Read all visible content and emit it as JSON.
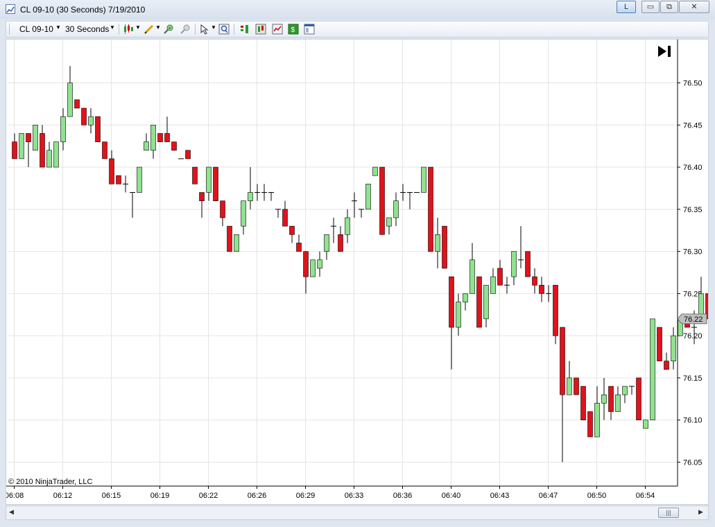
{
  "window": {
    "title": "CL 09-10 (30 Seconds)  7/19/2010",
    "buttons": {
      "lock": "L",
      "minimize": "▭",
      "restore": "⧉",
      "close": "✕"
    }
  },
  "toolbar": {
    "instrument": "CL 09-10",
    "interval": "30 Seconds",
    "icons": [
      "candlestick-icon",
      "pencil-icon",
      "zoom-in-icon",
      "zoom-out-icon",
      "cursor-icon",
      "magnify-icon",
      "bar-chart-icon",
      "candles-icon",
      "line-chart-icon",
      "dollar-icon",
      "properties-icon"
    ]
  },
  "colors": {
    "up": "#90e290",
    "down": "#e0131b",
    "wick": "#000000",
    "grid": "#e4e4e4",
    "price_marker": "#c0c0c0"
  },
  "chart": {
    "copyright": "© 2010 NinjaTrader, LLC",
    "end_button_icon": "go-to-end-icon",
    "last_price": "76.22"
  },
  "chart_data": {
    "type": "candlestick",
    "symbol": "CL 09-10",
    "interval": "30 Seconds",
    "date": "7/19/2010",
    "ylim": [
      76.03,
      76.55
    ],
    "y_ticks": [
      "76.50",
      "76.45",
      "76.40",
      "76.35",
      "76.30",
      "76.25",
      "76.20",
      "76.15",
      "76.10",
      "76.05"
    ],
    "x_ticks": [
      "06:08",
      "06:12",
      "06:15",
      "06:19",
      "06:22",
      "06:26",
      "06:29",
      "06:33",
      "06:36",
      "06:40",
      "06:43",
      "06:47",
      "06:50",
      "06:54"
    ],
    "candles": [
      [
        76.43,
        76.44,
        76.41,
        76.41
      ],
      [
        76.41,
        76.44,
        76.41,
        76.44
      ],
      [
        76.44,
        76.44,
        76.4,
        76.43
      ],
      [
        76.42,
        76.45,
        76.42,
        76.45
      ],
      [
        76.44,
        76.45,
        76.4,
        76.4
      ],
      [
        76.4,
        76.43,
        76.4,
        76.42
      ],
      [
        76.4,
        76.43,
        76.4,
        76.43
      ],
      [
        76.43,
        76.47,
        76.42,
        76.46
      ],
      [
        76.46,
        76.52,
        76.46,
        76.5
      ],
      [
        76.48,
        76.48,
        76.47,
        76.47
      ],
      [
        76.47,
        76.47,
        76.45,
        76.45
      ],
      [
        76.45,
        76.47,
        76.44,
        76.46
      ],
      [
        76.46,
        76.46,
        76.43,
        76.43
      ],
      [
        76.43,
        76.43,
        76.41,
        76.41
      ],
      [
        76.41,
        76.42,
        76.38,
        76.38
      ],
      [
        76.39,
        76.39,
        76.38,
        76.38
      ],
      [
        76.38,
        76.39,
        76.37,
        76.38
      ],
      [
        76.37,
        76.37,
        76.34,
        76.37
      ],
      [
        76.37,
        76.4,
        76.37,
        76.4
      ],
      [
        76.42,
        76.44,
        76.42,
        76.43
      ],
      [
        76.42,
        76.45,
        76.41,
        76.45
      ],
      [
        76.44,
        76.44,
        76.43,
        76.43
      ],
      [
        76.44,
        76.46,
        76.43,
        76.43
      ],
      [
        76.43,
        76.43,
        76.42,
        76.42
      ],
      [
        76.41,
        76.41,
        76.41,
        76.41
      ],
      [
        76.42,
        76.42,
        76.41,
        76.41
      ],
      [
        76.4,
        76.4,
        76.38,
        76.38
      ],
      [
        76.37,
        76.37,
        76.34,
        76.36
      ],
      [
        76.37,
        76.4,
        76.36,
        76.4
      ],
      [
        76.4,
        76.4,
        76.36,
        76.36
      ],
      [
        76.36,
        76.36,
        76.33,
        76.34
      ],
      [
        76.33,
        76.33,
        76.3,
        76.3
      ],
      [
        76.3,
        76.32,
        76.3,
        76.32
      ],
      [
        76.33,
        76.36,
        76.32,
        76.36
      ],
      [
        76.36,
        76.4,
        76.35,
        76.37
      ],
      [
        76.37,
        76.38,
        76.36,
        76.37
      ],
      [
        76.37,
        76.38,
        76.36,
        76.37
      ],
      [
        76.37,
        76.37,
        76.36,
        76.37
      ],
      [
        76.35,
        76.35,
        76.34,
        76.35
      ],
      [
        76.35,
        76.36,
        76.33,
        76.33
      ],
      [
        76.33,
        76.33,
        76.31,
        76.32
      ],
      [
        76.31,
        76.32,
        76.3,
        76.3
      ],
      [
        76.3,
        76.3,
        76.25,
        76.27
      ],
      [
        76.27,
        76.29,
        76.27,
        76.29
      ],
      [
        76.28,
        76.3,
        76.27,
        76.29
      ],
      [
        76.3,
        76.32,
        76.29,
        76.32
      ],
      [
        76.33,
        76.34,
        76.31,
        76.33
      ],
      [
        76.32,
        76.33,
        76.3,
        76.3
      ],
      [
        76.32,
        76.35,
        76.31,
        76.34
      ],
      [
        76.36,
        76.37,
        76.34,
        76.36
      ],
      [
        76.35,
        76.35,
        76.34,
        76.35
      ],
      [
        76.35,
        76.38,
        76.35,
        76.38
      ],
      [
        76.39,
        76.4,
        76.39,
        76.4
      ],
      [
        76.4,
        76.4,
        76.32,
        76.32
      ],
      [
        76.33,
        76.34,
        76.32,
        76.34
      ],
      [
        76.34,
        76.37,
        76.33,
        76.36
      ],
      [
        76.37,
        76.38,
        76.36,
        76.37
      ],
      [
        76.37,
        76.37,
        76.35,
        76.37
      ],
      [
        76.37,
        76.37,
        76.37,
        76.37
      ],
      [
        76.37,
        76.4,
        76.37,
        76.4
      ],
      [
        76.4,
        76.4,
        76.3,
        76.3
      ],
      [
        76.3,
        76.34,
        76.28,
        76.32
      ],
      [
        76.33,
        76.33,
        76.28,
        76.28
      ],
      [
        76.27,
        76.27,
        76.16,
        76.21
      ],
      [
        76.21,
        76.25,
        76.2,
        76.24
      ],
      [
        76.24,
        76.25,
        76.23,
        76.25
      ],
      [
        76.25,
        76.31,
        76.25,
        76.29
      ],
      [
        76.27,
        76.27,
        76.21,
        76.21
      ],
      [
        76.22,
        76.26,
        76.21,
        76.26
      ],
      [
        76.25,
        76.28,
        76.25,
        76.27
      ],
      [
        76.28,
        76.29,
        76.26,
        76.26
      ],
      [
        76.26,
        76.27,
        76.25,
        76.26
      ],
      [
        76.27,
        76.3,
        76.26,
        76.3
      ],
      [
        76.29,
        76.33,
        76.28,
        76.29
      ],
      [
        76.3,
        76.3,
        76.27,
        76.27
      ],
      [
        76.27,
        76.28,
        76.25,
        76.26
      ],
      [
        76.26,
        76.27,
        76.24,
        76.25
      ],
      [
        76.25,
        76.26,
        76.24,
        76.25
      ],
      [
        76.26,
        76.26,
        76.19,
        76.2
      ],
      [
        76.21,
        76.21,
        76.05,
        76.13
      ],
      [
        76.13,
        76.17,
        76.13,
        76.15
      ],
      [
        76.15,
        76.15,
        76.13,
        76.13
      ],
      [
        76.14,
        76.14,
        76.1,
        76.1
      ],
      [
        76.11,
        76.11,
        76.08,
        76.08
      ],
      [
        76.08,
        76.14,
        76.08,
        76.12
      ],
      [
        76.12,
        76.15,
        76.1,
        76.13
      ],
      [
        76.14,
        76.14,
        76.1,
        76.11
      ],
      [
        76.11,
        76.14,
        76.11,
        76.13
      ],
      [
        76.13,
        76.13,
        76.12,
        76.14
      ],
      [
        76.14,
        76.14,
        76.13,
        76.14
      ],
      [
        76.15,
        76.15,
        76.1,
        76.1
      ],
      [
        76.09,
        76.1,
        76.09,
        76.1
      ],
      [
        76.1,
        76.22,
        76.1,
        76.22
      ],
      [
        76.21,
        76.21,
        76.17,
        76.17
      ],
      [
        76.17,
        76.18,
        76.16,
        76.16
      ],
      [
        76.17,
        76.21,
        76.16,
        76.2
      ],
      [
        76.2,
        76.22,
        76.2,
        76.22
      ],
      [
        76.22,
        76.22,
        76.21,
        76.21
      ],
      [
        76.21,
        76.23,
        76.19,
        76.21
      ],
      [
        76.22,
        76.27,
        76.22,
        76.25
      ],
      [
        76.25,
        76.25,
        76.22,
        76.22
      ]
    ]
  }
}
